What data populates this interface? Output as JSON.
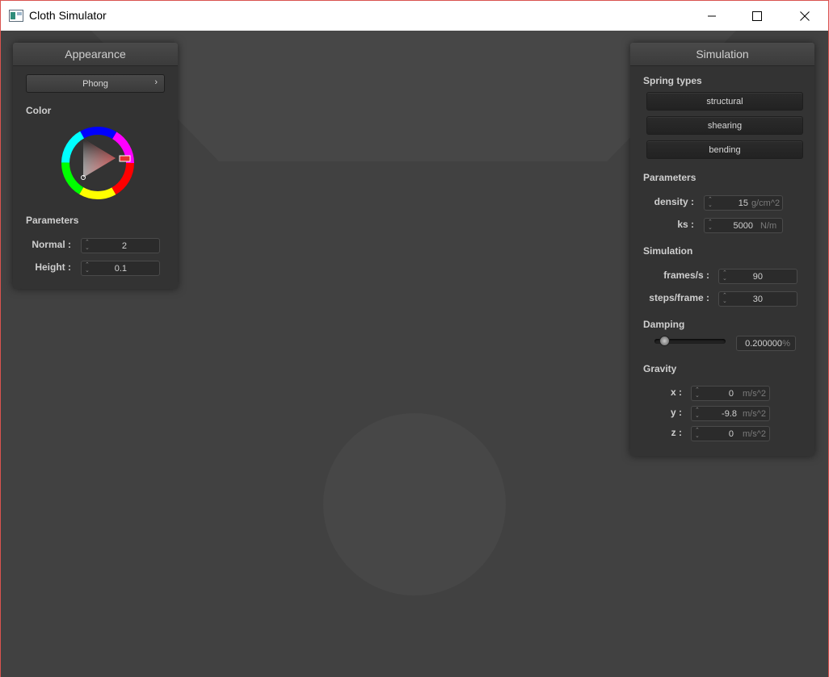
{
  "window": {
    "title": "Cloth Simulator"
  },
  "appearance": {
    "header": "Appearance",
    "shader_select": "Phong",
    "chevron": "›",
    "color_label": "Color",
    "params_label": "Parameters",
    "normal": {
      "label": "Normal :",
      "value": "2"
    },
    "height": {
      "label": "Height :",
      "value": "0.1"
    }
  },
  "simulation": {
    "header": "Simulation",
    "spring_types_label": "Spring types",
    "spring_types": [
      "structural",
      "shearing",
      "bending"
    ],
    "params_label": "Parameters",
    "density": {
      "label": "density :",
      "value": "15",
      "unit": "g/cm^2"
    },
    "ks": {
      "label": "ks :",
      "value": "5000",
      "unit": "N/m"
    },
    "sim_label": "Simulation",
    "fps": {
      "label": "frames/s :",
      "value": "90"
    },
    "steps": {
      "label": "steps/frame :",
      "value": "30"
    },
    "damping_label": "Damping",
    "damping": {
      "value": "0.200000",
      "unit": "%",
      "slider_fraction": 0.08
    },
    "gravity_label": "Gravity",
    "gx": {
      "label": "x :",
      "value": "0",
      "unit": "m/s^2"
    },
    "gy": {
      "label": "y :",
      "value": "-9.8",
      "unit": "m/s^2"
    },
    "gz": {
      "label": "z :",
      "value": "0",
      "unit": "m/s^2"
    }
  },
  "colors": {
    "viewport_bg": "#414141",
    "panel_bg": "#333333",
    "scene_shape": "#474747",
    "selected_color": "#e53030"
  }
}
